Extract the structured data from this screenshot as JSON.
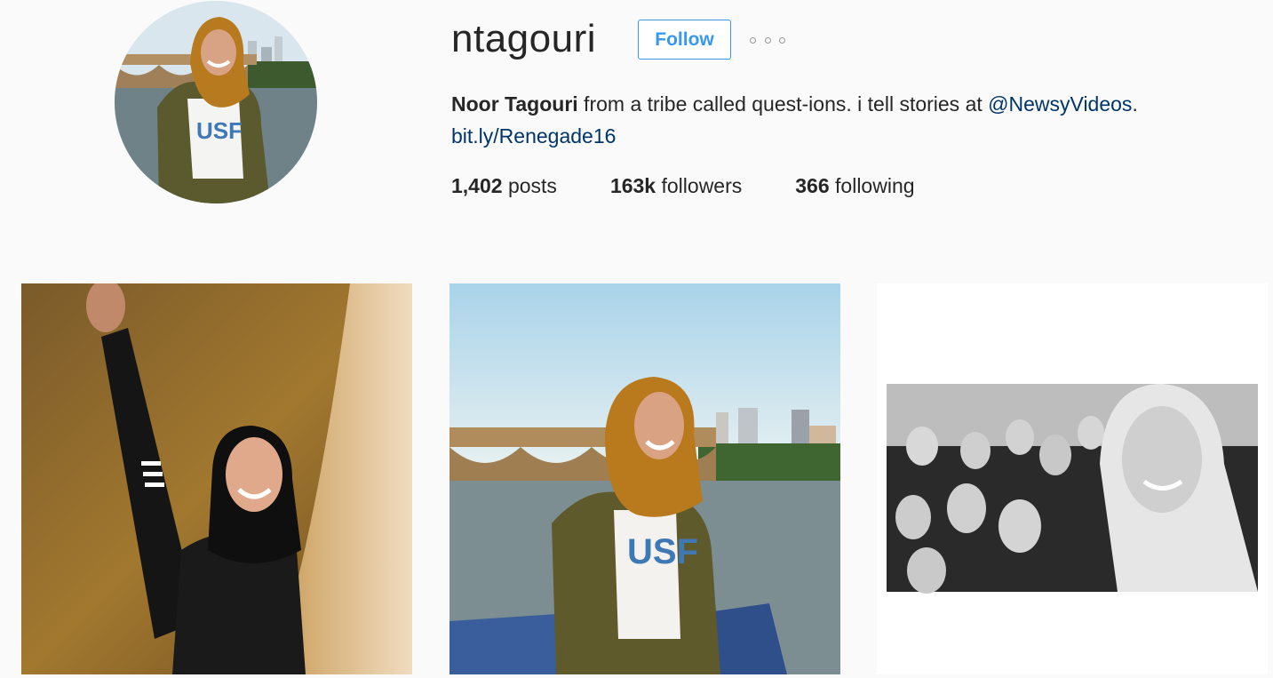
{
  "profile": {
    "username": "ntagouri",
    "follow_label": "Follow",
    "more_icon": "ellipsis-icon",
    "full_name": "Noor Tagouri",
    "bio_text": " from a tribe called quest-ions. i tell stories at ",
    "mention": "@NewsyVideos",
    "bio_end": ".",
    "link": "bit.ly/Renegade16"
  },
  "stats": {
    "posts_count": "1,402",
    "posts_label": " posts",
    "followers_count": "163k",
    "followers_label": " followers",
    "following_count": "366",
    "following_label": " following"
  },
  "colors": {
    "accent": "#3897f0",
    "link": "#003569",
    "background": "#fafafa",
    "text": "#262626"
  }
}
